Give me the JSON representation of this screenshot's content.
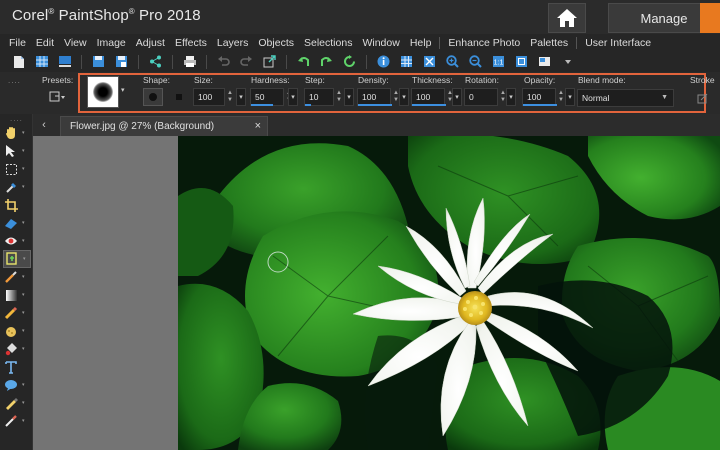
{
  "titlebar": {
    "app_name": "Corel",
    "app_reg": "®",
    "app_product": "PaintShop",
    "app_reg2": "®",
    "app_version": "Pro 2018",
    "home_icon": "home-icon",
    "manage_label": "Manage",
    "accent": "#e8791f"
  },
  "menu": {
    "items": [
      "File",
      "Edit",
      "View",
      "Image",
      "Adjust",
      "Effects",
      "Layers",
      "Objects",
      "Selections",
      "Window",
      "Help"
    ],
    "extra": [
      "Enhance Photo",
      "Palettes",
      "User Interface"
    ]
  },
  "tool_options": {
    "presets_label": "Presets:",
    "shape_label": "Shape:",
    "size_label": "Size:",
    "size_value": "100",
    "hardness_label": "Hardness:",
    "hardness_value": "50",
    "step_label": "Step:",
    "step_value": "10",
    "density_label": "Density:",
    "density_value": "100",
    "thickness_label": "Thickness:",
    "thickness_value": "100",
    "rotation_label": "Rotation:",
    "rotation_value": "0",
    "opacity_label": "Opacity:",
    "opacity_value": "100",
    "blend_label": "Blend mode:",
    "blend_value": "Normal",
    "stroke_label": "Stroke",
    "highlight_color": "#e2643c"
  },
  "document": {
    "tab_label": "Flower.jpg @  27% (Background)",
    "close_glyph": "×",
    "back_glyph": "‹"
  }
}
